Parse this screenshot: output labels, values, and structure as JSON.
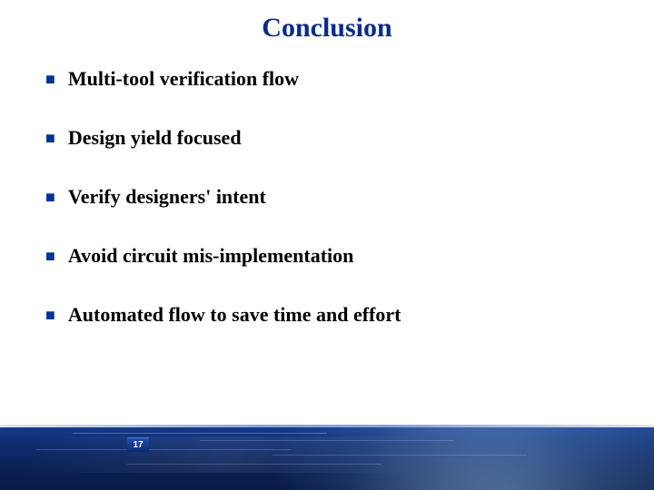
{
  "slide": {
    "title": "Conclusion",
    "bullets": [
      "Multi-tool verification flow",
      "Design yield focused",
      "Verify designers' intent",
      "Avoid circuit mis-implementation",
      "Automated flow to save time and effort"
    ],
    "page_number": "17"
  }
}
